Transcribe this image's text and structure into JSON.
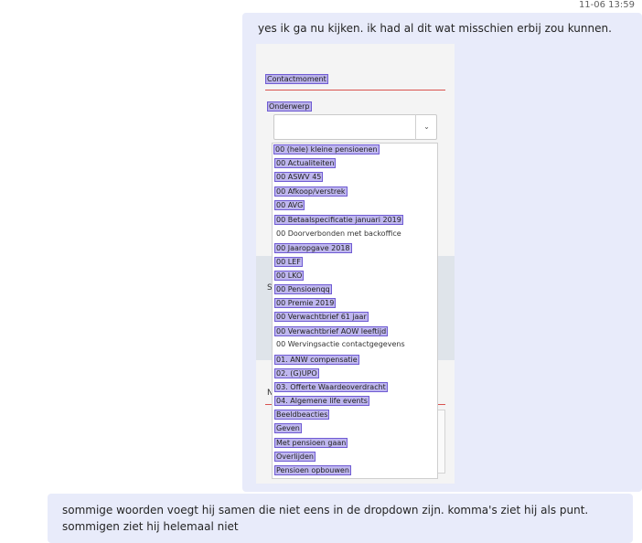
{
  "timestamp": "11-06 13:59",
  "message_top": {
    "text": "yes ik ga nu kijken. ik had al dit wat misschien erbij zou kunnen.",
    "image": {
      "heading": "Contactmoment",
      "field_label": "Onderwerp",
      "select_chevron": "⌄",
      "options": [
        "00 (hele) kleine pensioenen",
        "00 Actualiteiten",
        "00 ASWV 45",
        "00 Afkoop/verstrek",
        "00 AVG",
        "00 Betaalspecificatie januari 2019",
        "00 Doorverbonden met backoffice",
        "00 Jaaropgave 2018",
        "00 LEF",
        "00 LKO",
        "00 Pensioenqq",
        "00 Premie 2019",
        "00 Verwachtbrief 61 jaar",
        "00 Verwachtbrief AOW leeftijd",
        "00 Wervingsactie contactgegevens",
        "01. ANW compensatie",
        "02. (G)UPO",
        "03. Offerte Waardeoverdracht",
        "04. Algemene life events",
        "Beeldbeacties",
        "Geven",
        "Met pensioen gaan",
        "Overlijden",
        "Pensioen opbouwen"
      ],
      "side_fragments": [
        "S",
        "N"
      ]
    }
  },
  "message_bottom": {
    "line1": "sommige woorden voegt hij samen die niet eens in de dropdown zijn. komma's ziet hij als punt.",
    "line2": "sommigen ziet hij helemaal niet"
  }
}
